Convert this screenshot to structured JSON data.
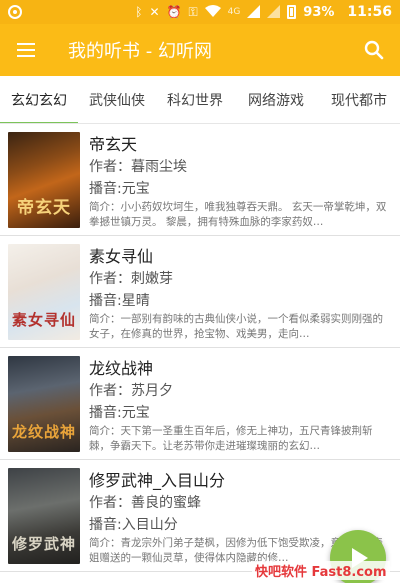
{
  "status_bar": {
    "battery": "93%",
    "time": "11:56",
    "network": "4G"
  },
  "app_bar": {
    "title": "我的听书 - 幻听网"
  },
  "tabs": [
    {
      "label": "玄幻玄幻",
      "active": true
    },
    {
      "label": "武侠仙侠",
      "active": false
    },
    {
      "label": "科幻世界",
      "active": false
    },
    {
      "label": "网络游戏",
      "active": false
    },
    {
      "label": "现代都市",
      "active": false
    }
  ],
  "books": [
    {
      "title": "帝玄天",
      "author": "作者：暮雨尘埃",
      "narrator": "播音:元宝",
      "description": "简介：小小药奴坎坷生，唯我独尊吞天鼎。 玄天一帝掌乾坤，双拳撼世镇万灵。 黎晨，拥有特殊血脉的李家药奴…",
      "cover_text": "帝玄天"
    },
    {
      "title": "素女寻仙",
      "author": "作者：刺嫩芽",
      "narrator": "播音:星晴",
      "description": "简介：一部别有韵味的古典仙侠小说，一个看似柔弱实则刚强的女子，在修真的世界，抢宝物、戏美男，走向…",
      "cover_text": "素女寻仙"
    },
    {
      "title": "龙纹战神",
      "author": "作者：苏月夕",
      "narrator": "播音:元宝",
      "description": "简介：天下第一圣重生百年后，修无上神功，五尺青锋披荆斩棘，争霸天下。让老苏带你走进璀璨瑰丽的玄幻…",
      "cover_text": "龙纹战神"
    },
    {
      "title": "修罗武神_入目山分",
      "author": "作者：善良的蜜蜂",
      "narrator": "播音:入目山分",
      "description": "简介：青龙宗外门弟子楚枫，因修为低下饱受欺凌，意外获得表姐赠送的一颗仙灵草，使得体内隐藏的修…",
      "cover_text": "修罗武神"
    }
  ],
  "watermark": "快吧软件 Fast8.com",
  "colors": {
    "status_bar": "#f7b413",
    "app_bar": "#fbbb16",
    "tab_indicator": "#7cc45a",
    "fab": "#8bc34a"
  }
}
